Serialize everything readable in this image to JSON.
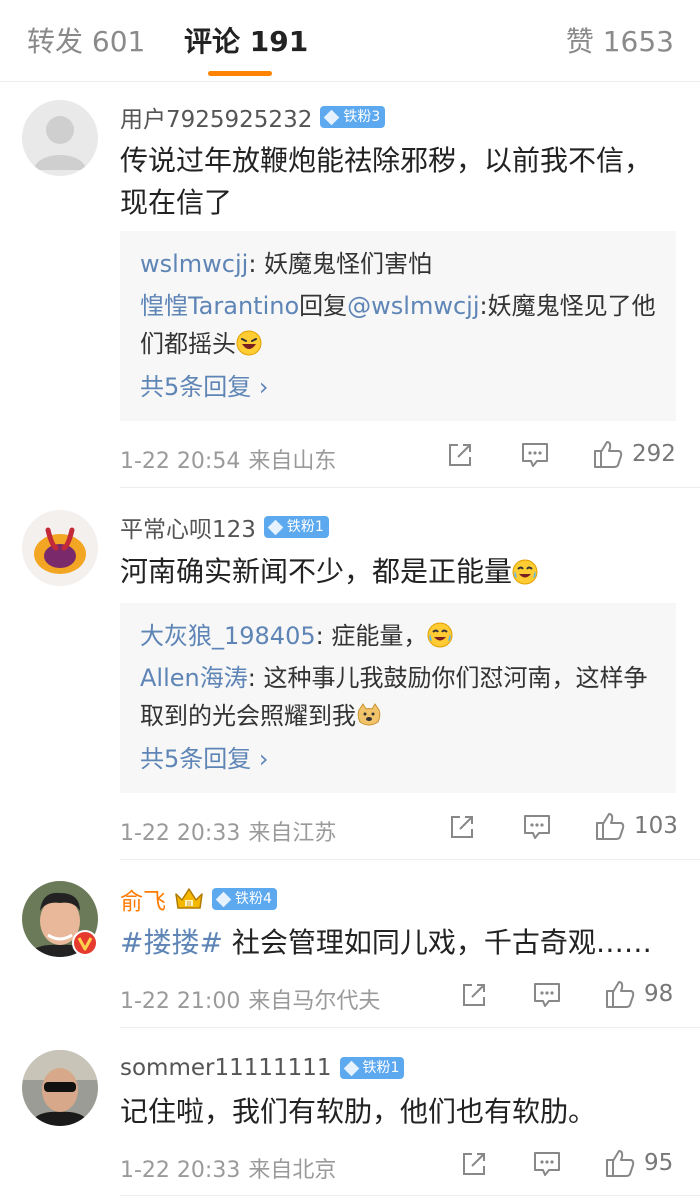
{
  "tabs": {
    "repost": "转发 601",
    "comments": "评论 191",
    "likes": "赞 1653"
  },
  "comments": [
    {
      "username": "用户7925925232",
      "badge": "铁粉3",
      "text": "传说过年放鞭炮能祛除邪秽，以前我不信，现在信了",
      "replies": [
        {
          "name": "wslmwcjj",
          "sep": ": ",
          "text": "妖魔鬼怪们害怕"
        },
        {
          "name": "惶惶Tarantino",
          "reply_word": "回复",
          "target": "@wslmwcjj",
          "sep": ":",
          "text": "妖魔鬼怪见了他们都摇头"
        }
      ],
      "more": "共5条回复 ›",
      "time": "1-22 20:54",
      "source": "来自山东",
      "likes": "292"
    },
    {
      "username": "平常心呗123",
      "badge": "铁粉1",
      "text": "河南确实新闻不少，都是正能量",
      "replies": [
        {
          "name": "大灰狼_198405",
          "sep": ": ",
          "text": "症能量，"
        },
        {
          "name": "Allen海涛",
          "sep": ": ",
          "text": "这种事儿我鼓励你们怼河南，这样争取到的光会照耀到我"
        }
      ],
      "more": "共5条回复 ›",
      "time": "1-22 20:33",
      "source": "来自江苏",
      "likes": "103"
    },
    {
      "username": "俞飞",
      "badge": "铁粉4",
      "hashtag": "#搂搂#",
      "text": " 社会管理如同儿戏，千古奇观……",
      "time": "1-22 21:00",
      "source": "来自马尔代夫",
      "likes": "98"
    },
    {
      "username": "sommer11111111",
      "badge": "铁粉1",
      "text": "记住啦，我们有软肋，他们也有软肋。",
      "time": "1-22 20:33",
      "source": "来自北京",
      "likes": "95"
    }
  ],
  "colors": {
    "accent": "#ff8200",
    "link": "#5e85b6",
    "badge": "#5da9f0",
    "vip_name": "#ff7a00"
  },
  "icons": [
    "share-icon",
    "comment-icon",
    "like-icon",
    "diamond-icon",
    "crown-icon",
    "verified-icon",
    "laughing-emoji",
    "crying-laughing-emoji",
    "doge-emoji"
  ]
}
